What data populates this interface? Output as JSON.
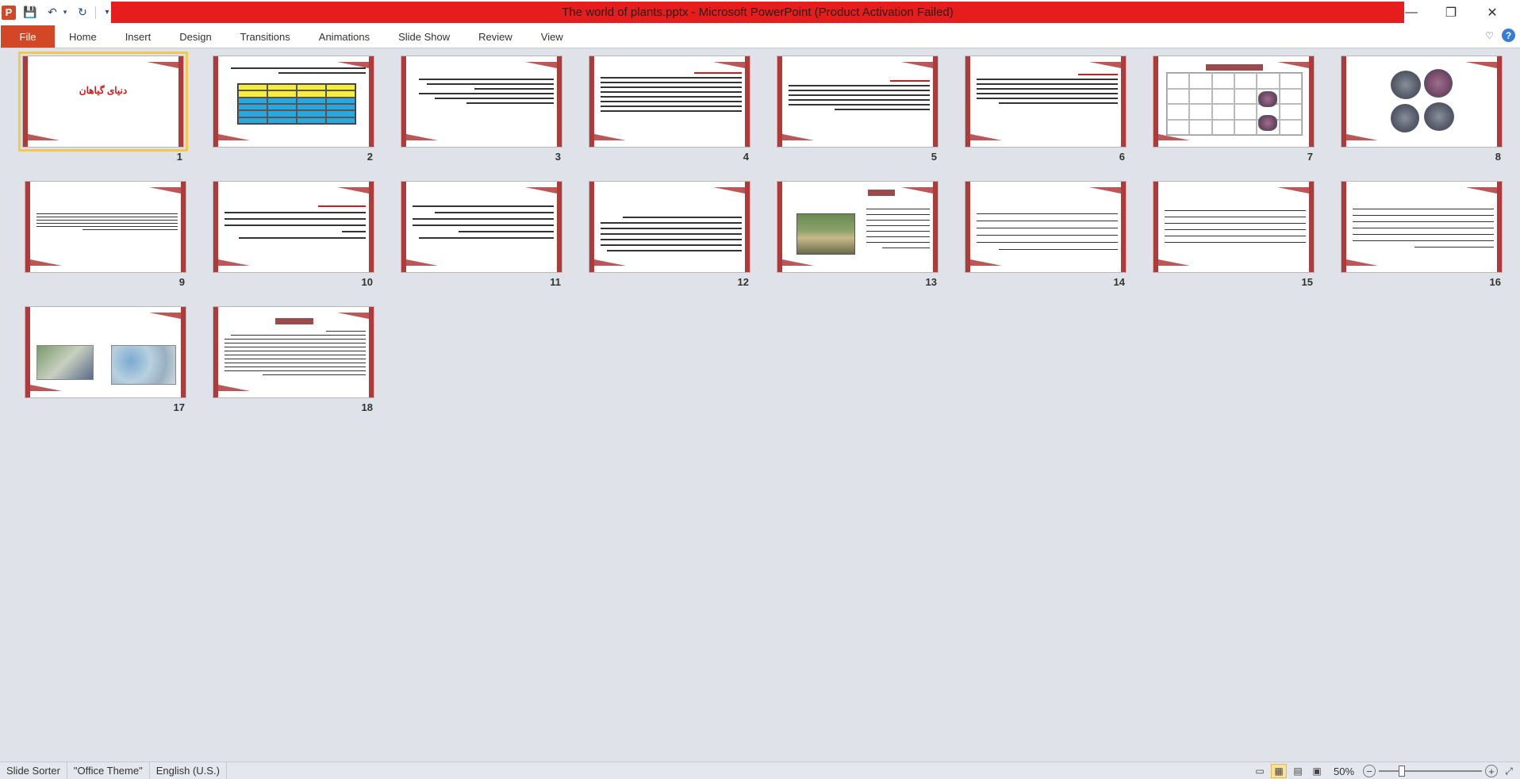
{
  "window": {
    "title": "The world of plants.pptx  -  Microsoft PowerPoint (Product Activation Failed)",
    "app_letter": "P",
    "controls": {
      "minimize": "—",
      "restore": "❐",
      "close": "✕"
    }
  },
  "ribbon": {
    "file_label": "File",
    "tabs": [
      "Home",
      "Insert",
      "Design",
      "Transitions",
      "Animations",
      "Slide Show",
      "Review",
      "View"
    ],
    "help_icon": "?"
  },
  "colors": {
    "accent": "#d24726",
    "title_bar": "#e51d1d",
    "slide_frame": "#b03a3a",
    "selection": "#f2c94c"
  },
  "slides": [
    {
      "number": "1",
      "title": "دنیای گیاهان",
      "selected": true
    },
    {
      "number": "2"
    },
    {
      "number": "3"
    },
    {
      "number": "4"
    },
    {
      "number": "5"
    },
    {
      "number": "6"
    },
    {
      "number": "7"
    },
    {
      "number": "8"
    },
    {
      "number": "9"
    },
    {
      "number": "10"
    },
    {
      "number": "11"
    },
    {
      "number": "12"
    },
    {
      "number": "13"
    },
    {
      "number": "14"
    },
    {
      "number": "15"
    },
    {
      "number": "16"
    },
    {
      "number": "17"
    },
    {
      "number": "18"
    }
  ],
  "statusbar": {
    "view_name": "Slide Sorter",
    "theme": "\"Office Theme\"",
    "language": "English (U.S.)",
    "zoom": "50%",
    "zoom_value": 50
  }
}
